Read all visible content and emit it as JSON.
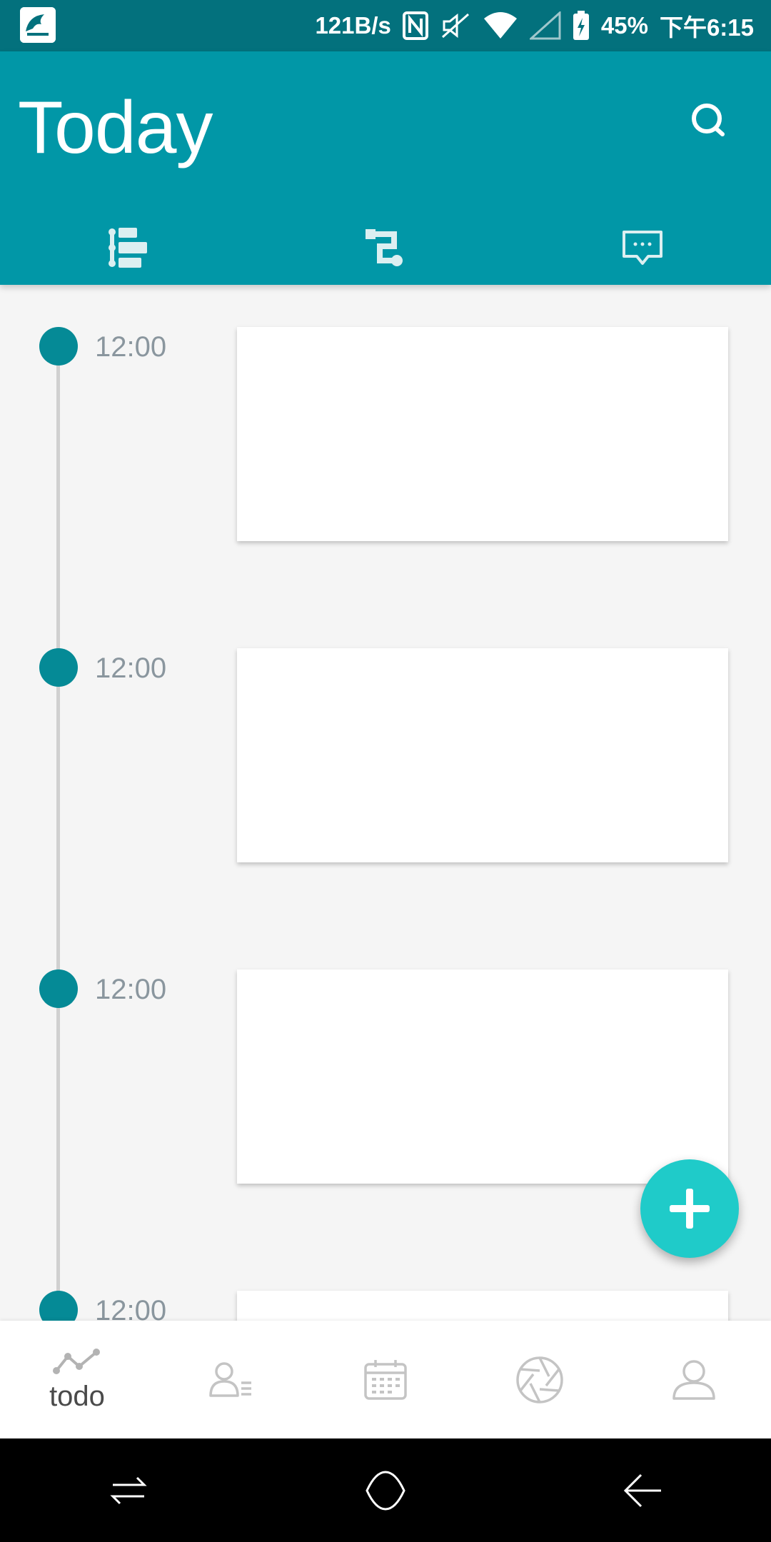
{
  "status_bar": {
    "net_speed": "121B/s",
    "battery": "45%",
    "time": "下午6:15"
  },
  "app_bar": {
    "title": "Today"
  },
  "tabs": [
    {
      "icon": "task-list-icon"
    },
    {
      "icon": "route-icon"
    },
    {
      "icon": "chat-icon"
    }
  ],
  "timeline": {
    "items": [
      {
        "time": "12:00"
      },
      {
        "time": "12:00"
      },
      {
        "time": "12:00"
      },
      {
        "time": "12:00"
      }
    ]
  },
  "bottom_nav": {
    "items": [
      {
        "label": "todo",
        "icon": "trend-icon",
        "active": true
      },
      {
        "label": "",
        "icon": "contacts-icon",
        "active": false
      },
      {
        "label": "",
        "icon": "calendar-icon",
        "active": false
      },
      {
        "label": "",
        "icon": "aperture-icon",
        "active": false
      },
      {
        "label": "",
        "icon": "profile-icon",
        "active": false
      }
    ]
  },
  "colors": {
    "status_bar": "#03717d",
    "app_bar": "#0197a7",
    "timeline_dot": "#058a96",
    "fab": "#1fcbc9"
  }
}
